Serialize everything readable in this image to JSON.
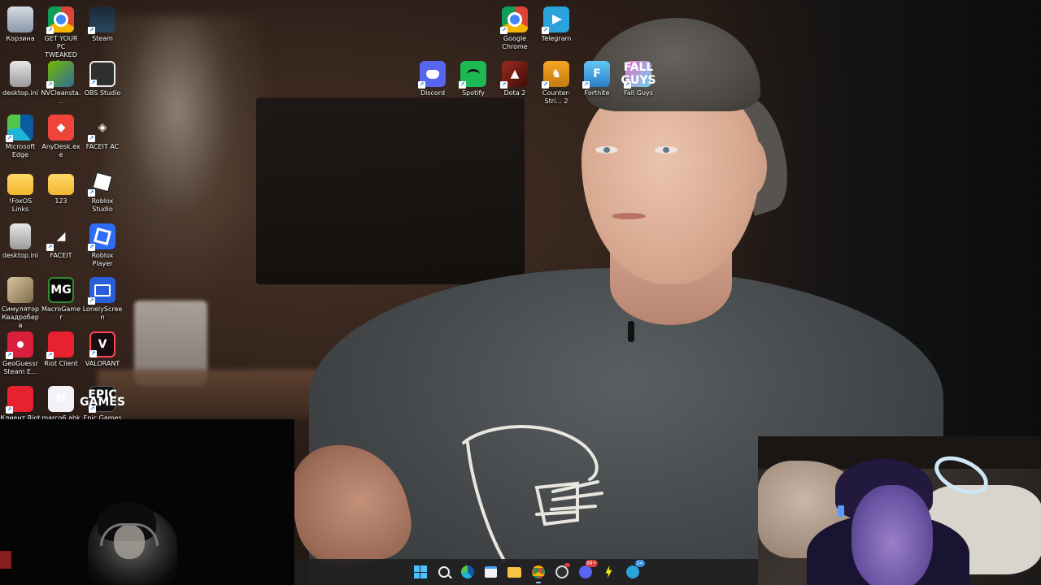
{
  "desktop": {
    "icons": [
      {
        "key": "recycle_bin",
        "label": "Корзина",
        "glyph": "recycle-bin-icon"
      },
      {
        "key": "get_pc_tweaked",
        "label": "GET YOUR PC TWEAKED A...",
        "glyph": "chrome-icon"
      },
      {
        "key": "steam",
        "label": "Steam",
        "glyph": "steam-icon"
      },
      {
        "key": "desktop_ini_1",
        "label": "desktop.ini",
        "glyph": "file-icon"
      },
      {
        "key": "nvcleanstall",
        "label": "NVCleansta...",
        "glyph": "nvcleanstall-icon"
      },
      {
        "key": "obs",
        "label": "OBS Studio",
        "glyph": "obs-icon"
      },
      {
        "key": "edge",
        "label": "Microsoft Edge",
        "glyph": "edge-icon"
      },
      {
        "key": "anydesk",
        "label": "AnyDesk.exe",
        "glyph": "anydesk-icon"
      },
      {
        "key": "faceit_ac",
        "label": "FACEIT AC",
        "glyph": "faceit-ac-icon"
      },
      {
        "key": "foxos_links",
        "label": "!FoxOS Links",
        "glyph": "folder-icon"
      },
      {
        "key": "folder_123",
        "label": "123",
        "glyph": "folder-icon"
      },
      {
        "key": "roblox_studio",
        "label": "Roblox Studio",
        "glyph": "roblox-studio-icon"
      },
      {
        "key": "desktop_ini_2",
        "label": "desktop.ini",
        "glyph": "file-icon"
      },
      {
        "key": "faceit",
        "label": "FACEIT",
        "glyph": "faceit-icon"
      },
      {
        "key": "roblox_player",
        "label": "Roblox Player",
        "glyph": "roblox-icon"
      },
      {
        "key": "sim_kvadrobera",
        "label": "Симулятор Квадробера",
        "glyph": "game-icon"
      },
      {
        "key": "macrogamer",
        "label": "MacroGamer",
        "glyph": "macrogamer-icon"
      },
      {
        "key": "lonelyscreen",
        "label": "LonelyScreen",
        "glyph": "lonelyscreen-icon"
      },
      {
        "key": "geoguessr",
        "label": "GeoGuessr Steam E...",
        "glyph": "geoguessr-icon"
      },
      {
        "key": "riot_client",
        "label": "Riot Client",
        "glyph": "riot-icon"
      },
      {
        "key": "valorant",
        "label": "VALORANT",
        "glyph": "valorant-icon"
      },
      {
        "key": "riot_client_ru",
        "label": "Клиент Riot",
        "glyph": "riot-icon"
      },
      {
        "key": "marco_ahk",
        "label": "marco6.ahk",
        "glyph": "autohotkey-icon"
      },
      {
        "key": "epic_games",
        "label": "Epic Games",
        "glyph": "epic-games-icon"
      },
      {
        "key": "google_chrome",
        "label": "Google Chrome",
        "glyph": "chrome-icon"
      },
      {
        "key": "telegram",
        "label": "Telegram",
        "glyph": "telegram-icon"
      },
      {
        "key": "discord",
        "label": "Discord",
        "glyph": "discord-icon"
      },
      {
        "key": "spotify",
        "label": "Spotify",
        "glyph": "spotify-icon"
      },
      {
        "key": "dota2",
        "label": "Dota 2",
        "glyph": "dota-icon"
      },
      {
        "key": "counter_strike",
        "label": "Counter-Stri... 2",
        "glyph": "counter-strike-icon"
      },
      {
        "key": "fortnite",
        "label": "Fortnite",
        "glyph": "fortnite-icon"
      },
      {
        "key": "fall_guys",
        "label": "Fall Guys",
        "glyph": "fall-guys-icon"
      }
    ],
    "glyph_text": {
      "macrogamer": "MG",
      "fortnite": "F",
      "ahk": "H",
      "epic": "EPIC GAMES",
      "valorant": "V",
      "anydesk": "◆",
      "faceit": "◢",
      "faceit_ac": "◈",
      "cs": "♞",
      "fallguys": "FALL GUYS",
      "dota": "▲"
    }
  },
  "taskbar": {
    "items": [
      {
        "name": "start-button",
        "glyph": "windows-icon"
      },
      {
        "name": "search-button",
        "glyph": "search-icon"
      },
      {
        "name": "edge-taskbar",
        "glyph": "edge-icon"
      },
      {
        "name": "store-taskbar",
        "glyph": "store-icon"
      },
      {
        "name": "explorer-taskbar",
        "glyph": "folder-icon"
      },
      {
        "name": "chrome-taskbar",
        "glyph": "chrome-icon",
        "active": true
      },
      {
        "name": "obs-taskbar",
        "glyph": "obs-icon",
        "badge": ""
      },
      {
        "name": "discord-taskbar",
        "glyph": "discord-icon",
        "badge": "99+"
      },
      {
        "name": "bolt-taskbar",
        "glyph": "bolt-icon"
      },
      {
        "name": "telegram-taskbar",
        "glyph": "telegram-icon",
        "badge": "24"
      }
    ]
  },
  "colors": {
    "taskbar_bg": "#202022",
    "accent": "#4cc2ff",
    "badge_red": "#d83b3b",
    "badge_blue": "#2c8ce0"
  }
}
